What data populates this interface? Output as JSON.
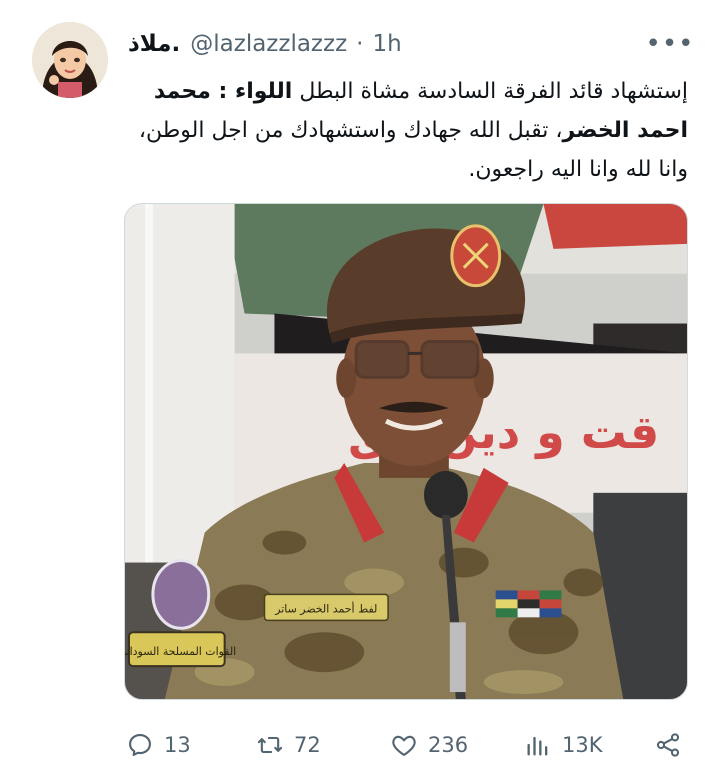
{
  "tweet": {
    "display_name": "ملاذ.",
    "handle": "@lazlazzlazzz",
    "separator": "·",
    "time": "1h",
    "more_label": "•••",
    "text_lines": [
      {
        "normal": "إستشهاد قائد الفرقة السادسة مشاة البطل ",
        "bold": "اللواء : محمد"
      },
      {
        "bold": "احمد الخضر",
        "normal": "، تقبل الله جهادك واستشهادك من اجل الوطن،"
      },
      {
        "normal": "وانا لله وانا اليه راجعون."
      }
    ],
    "media": {
      "banner_text": "قت و دين    حق",
      "nametag_text": "لفط أحمد الخضر ساتر",
      "shoulder_patch_text": "القوات المسلحة السودانية"
    }
  },
  "actions": {
    "reply": {
      "icon": "reply-icon",
      "count": "13"
    },
    "retweet": {
      "icon": "retweet-icon",
      "count": "72"
    },
    "like": {
      "icon": "heart-icon",
      "count": "236"
    },
    "views": {
      "icon": "views-icon",
      "count": "13K"
    },
    "share": {
      "icon": "share-icon"
    }
  },
  "colors": {
    "text": "#0f1419",
    "muted": "#536471",
    "border": "#cfd9de"
  }
}
